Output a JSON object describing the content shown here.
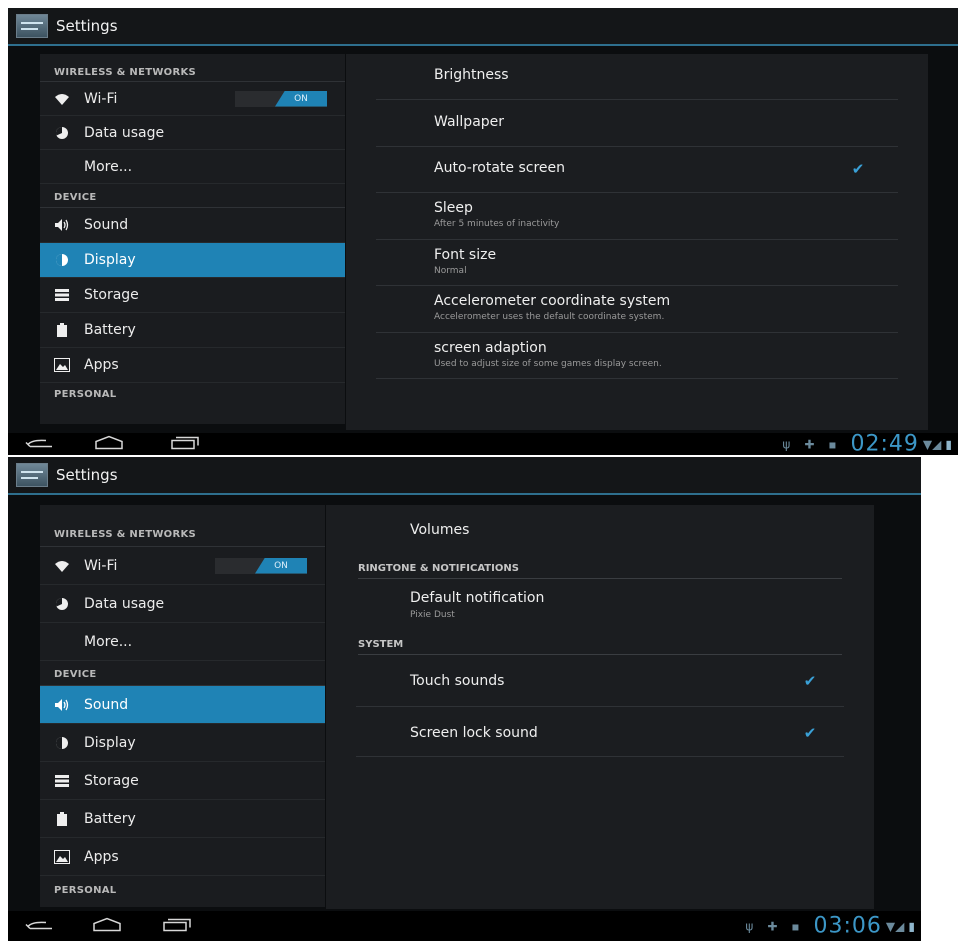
{
  "screen1": {
    "title": "Settings",
    "sidebar": {
      "sections": {
        "wireless": "WIRELESS & NETWORKS",
        "device": "DEVICE",
        "personal": "PERSONAL"
      },
      "items": {
        "wifi": "Wi-Fi",
        "wifi_toggle": "ON",
        "data_usage": "Data usage",
        "more": "More...",
        "sound": "Sound",
        "display": "Display",
        "storage": "Storage",
        "battery": "Battery",
        "apps": "Apps"
      },
      "active": "Display"
    },
    "content": {
      "brightness": "Brightness",
      "wallpaper": "Wallpaper",
      "auto_rotate": "Auto-rotate screen",
      "auto_rotate_checked": true,
      "sleep": "Sleep",
      "sleep_summary": "After 5 minutes of inactivity",
      "font_size": "Font size",
      "font_size_summary": "Normal",
      "accelerometer": "Accelerometer coordinate system",
      "accelerometer_summary": "Accelerometer uses the default coordinate system.",
      "screen_adaption": "screen adaption",
      "screen_adaption_summary": "Used to adjust size of some games display screen."
    },
    "status": {
      "clock": "02:49"
    }
  },
  "screen2": {
    "title": "Settings",
    "sidebar": {
      "sections": {
        "wireless": "WIRELESS & NETWORKS",
        "device": "DEVICE",
        "personal": "PERSONAL"
      },
      "items": {
        "wifi": "Wi-Fi",
        "wifi_toggle": "ON",
        "data_usage": "Data usage",
        "more": "More...",
        "sound": "Sound",
        "display": "Display",
        "storage": "Storage",
        "battery": "Battery",
        "apps": "Apps"
      },
      "active": "Sound"
    },
    "content": {
      "volumes": "Volumes",
      "ringtone_header": "RINGTONE & NOTIFICATIONS",
      "default_notification": "Default notification",
      "default_notification_summary": "Pixie Dust",
      "system_header": "SYSTEM",
      "touch_sounds": "Touch sounds",
      "touch_sounds_checked": true,
      "screen_lock_sound": "Screen lock sound",
      "screen_lock_sound_checked": true
    },
    "status": {
      "clock": "03:06"
    }
  },
  "colors": {
    "accent": "#1f83b5",
    "background": "#0b0d0f",
    "panel": "#1b1d20"
  }
}
